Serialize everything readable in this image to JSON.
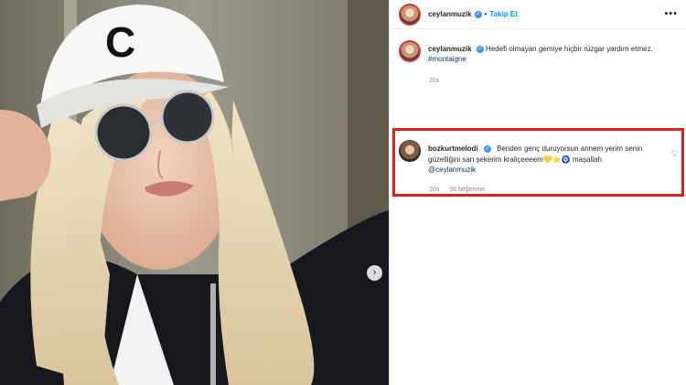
{
  "post": {
    "author": "ceylanmuzik",
    "dot": "•",
    "follow_label": "Takip Et",
    "more_icon": "more-dots-icon",
    "caption_text": "Hedefi olmayan gemiye hiçbir rüzgar yardım etmez.",
    "hashtag": "#montaigne",
    "caption_time": "20s",
    "verified_glyph": "✓"
  },
  "photo": {
    "next_arrow": "›"
  },
  "comment": {
    "author": "bozkurtmelodi",
    "text": "Benden genç duruyorsun annem yerim senin güzelliğini san şekerim kraliçeeeem💛⭐🧿 maşallah",
    "mention": "@ceylanmuzik",
    "time": "20s",
    "likes": "56 beğenme",
    "heart": "♡"
  },
  "colors": {
    "highlight_border": "#e41f1f",
    "follow_blue": "#0095f6",
    "verified_blue": "#3897f0"
  }
}
